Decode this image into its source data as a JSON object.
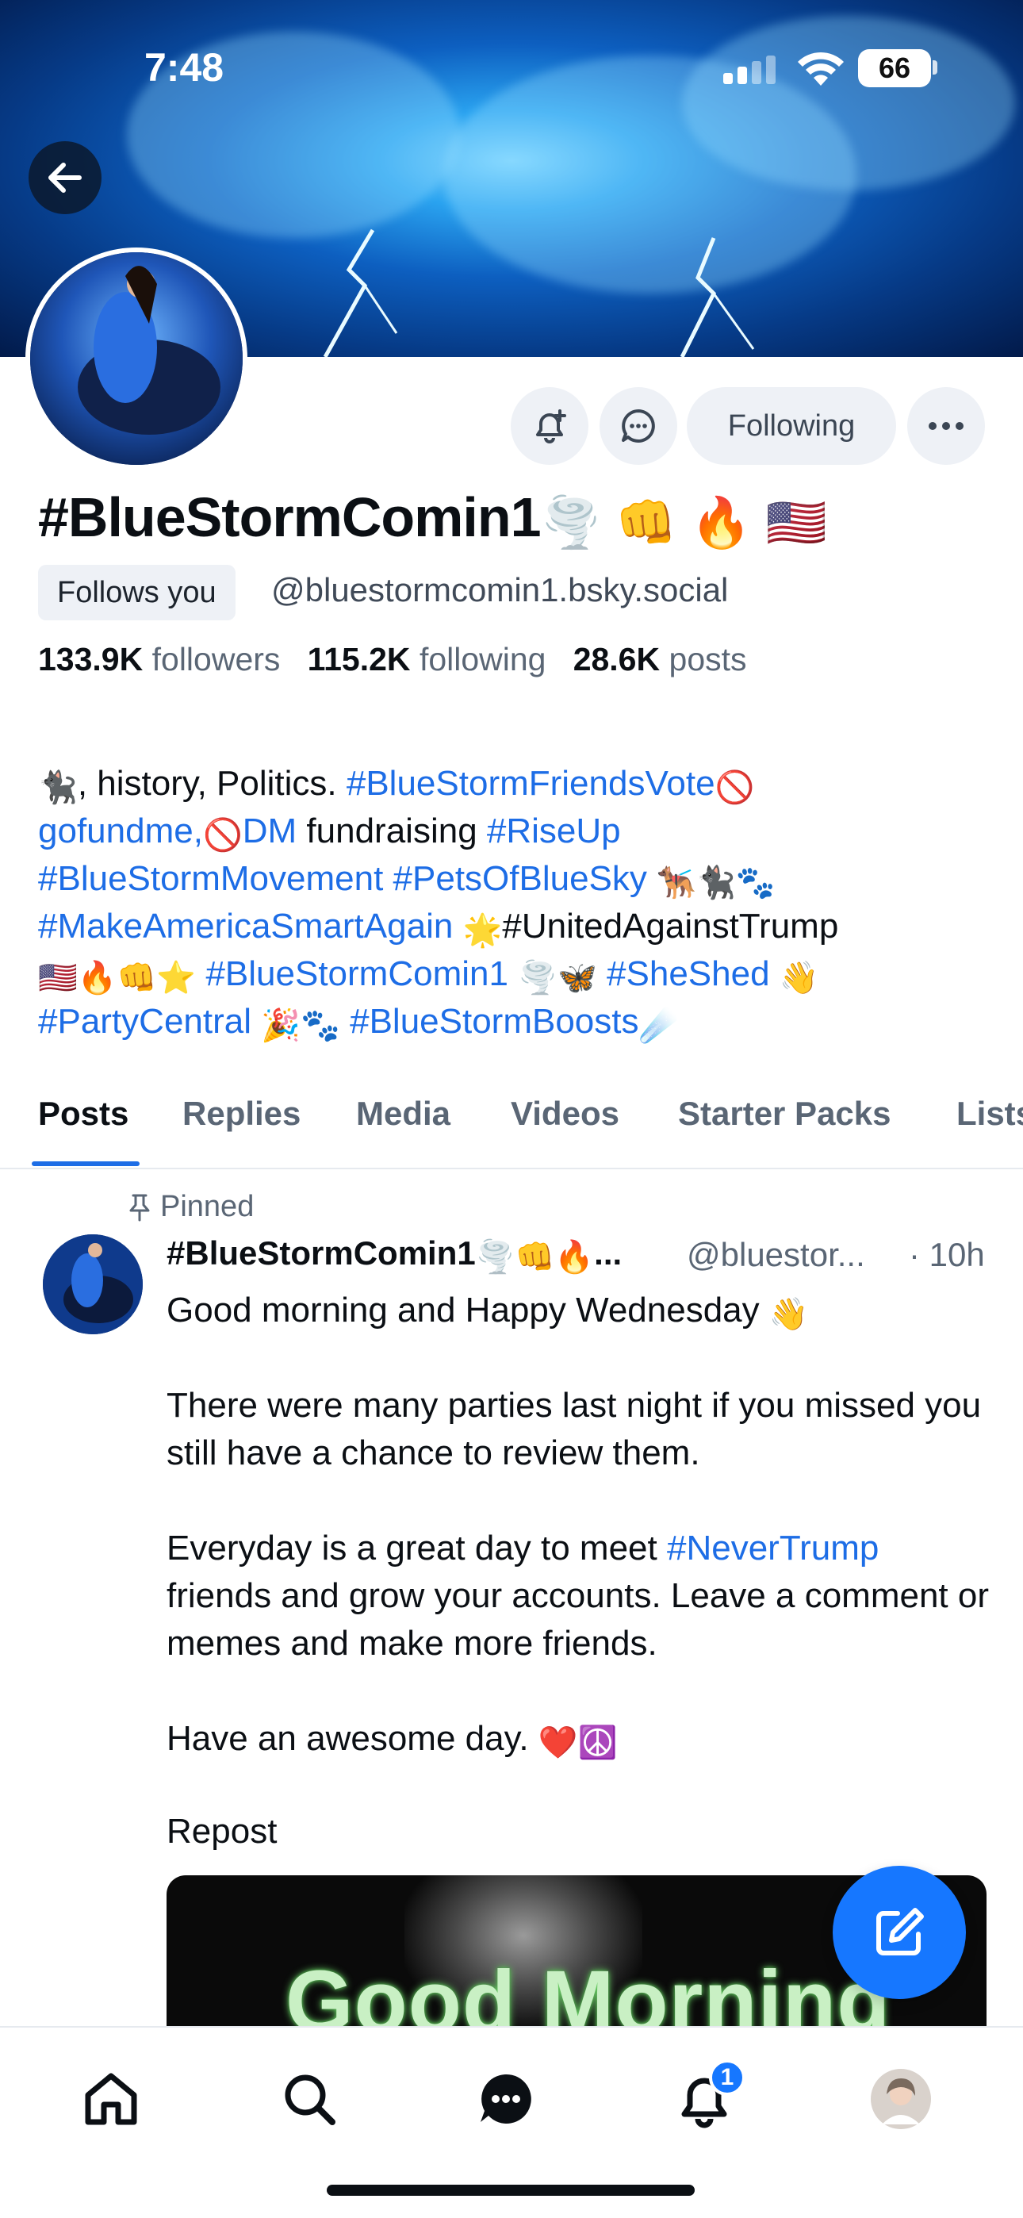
{
  "status_bar": {
    "time": "7:48",
    "battery": "66"
  },
  "profile": {
    "display_name": "#BlueStormComin1",
    "display_name_emoji": [
      "🌪️",
      "👊",
      "🔥",
      "🇺🇸"
    ],
    "follows_you": "Follows you",
    "handle": "@bluestormcomin1.bsky.social",
    "followers_count": "133.9K",
    "followers_label": "followers",
    "following_count": "115.2K",
    "following_label": "following",
    "posts_count": "28.6K",
    "posts_label": "posts"
  },
  "actions": {
    "following_label": "Following"
  },
  "bio": {
    "l1_emoji": "🐈‍⬛",
    "l1_text": ", history, Politics. ",
    "l1_tag": "#BlueStormFriendsVote",
    "l1_emoji2": "🚫",
    "l2_tag1": "gofundme,",
    "l2_emoji": "🚫",
    "l2_tag2": "DM",
    "l2_text": " fundraising ",
    "l2_tag3": "#RiseUp",
    "l3_tag1": "#BlueStormMovement",
    "l3_tag2": "#PetsOfBlueSky",
    "l3_emoji": "🐕‍🦺🐈‍⬛🐾",
    "l4_tag": "#MakeAmericaSmartAgain",
    "l4_emoji": "🌟",
    "l4_text": "#UnitedAgainstTrump",
    "l5_emoji1": "🇺🇸🔥👊⭐",
    "l5_tag1": "#BlueStormComin1",
    "l5_emoji2": "🌪️🦋",
    "l5_tag2": "#SheShed",
    "l5_emoji3": "👋",
    "l6_tag1": "#PartyCentral",
    "l6_emoji1": "🎉🐾",
    "l6_tag2": "#BlueStormBoosts",
    "l6_emoji2": "☄️"
  },
  "tabs": [
    "Posts",
    "Replies",
    "Media",
    "Videos",
    "Starter Packs",
    "Lists"
  ],
  "post": {
    "pinned_label": "Pinned",
    "author": "#BlueStormComin1",
    "author_emoji": "🌪️👊🔥",
    "author_ellipsis": "...",
    "handle": "@bluestor...",
    "time": "· 10h",
    "line1": "Good morning and Happy Wednesday ",
    "line1_emoji": "👋",
    "para2": "There were many parties last night if you missed you still have a chance to review them.",
    "para3_before": "Everyday is a great day to meet ",
    "para3_tag": "#NeverTrump",
    "para3_after": " friends and grow your accounts.  Leave a comment or memes and make more friends.",
    "para4": "Have an awesome day. ",
    "para4_emoji": "❤️☮️",
    "repost_label": "Repost",
    "repost_image_text": "Good Morning"
  },
  "bottom_nav": {
    "notification_count": "1"
  },
  "colors": {
    "accent": "#1677ff",
    "link": "#1d6de6",
    "banner": "#0d5fc0"
  }
}
